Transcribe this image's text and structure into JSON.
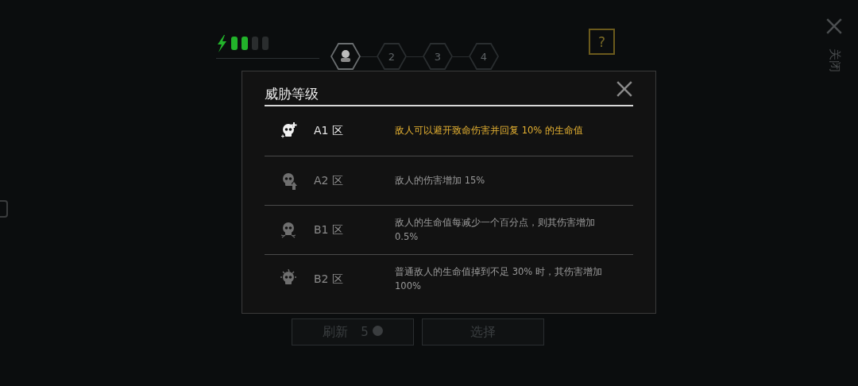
{
  "side_close": {
    "label": "关闭"
  },
  "energy": {
    "pips": [
      {
        "on": true
      },
      {
        "on": true
      },
      {
        "on": false
      },
      {
        "on": false
      }
    ]
  },
  "steps": [
    {
      "kind": "icon",
      "selected": true
    },
    {
      "kind": "number",
      "label": "2",
      "selected": false
    },
    {
      "kind": "number",
      "label": "3",
      "selected": false
    },
    {
      "kind": "number",
      "label": "4",
      "selected": false
    }
  ],
  "help": {
    "label": "?"
  },
  "buttons": [
    {
      "kind": "refresh",
      "label": "刷新",
      "count": "5"
    },
    {
      "kind": "plain",
      "label": "选择"
    }
  ],
  "dialog": {
    "title": "威胁等级",
    "rows": [
      {
        "kind": "heal",
        "zone": "A1 区",
        "text": "敌人可以避开致命伤害并回复 10% 的生命值",
        "selected": true
      },
      {
        "kind": "up",
        "zone": "A2 区",
        "text": "敌人的伤害增加 15%",
        "selected": false
      },
      {
        "kind": "splash",
        "zone": "B1 区",
        "text": "敌人的生命值每减少一个百分点，则其伤害增加 0.5%",
        "selected": false
      },
      {
        "kind": "burst",
        "zone": "B2 区",
        "text": "普通敌人的生命值掉到不足 30% 时，其伤害增加 100%",
        "selected": false
      }
    ]
  }
}
